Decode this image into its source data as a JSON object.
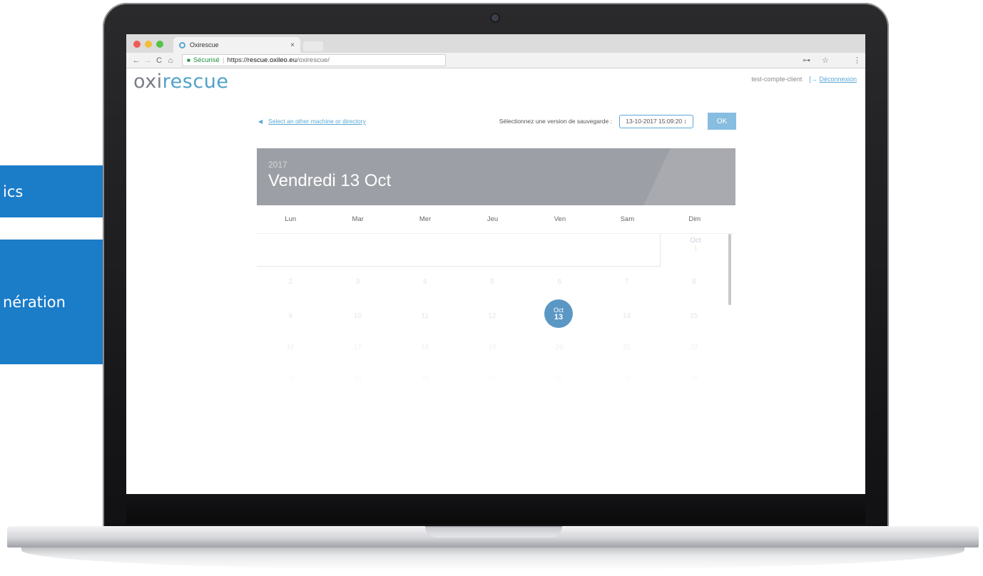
{
  "side_boxes": {
    "box1_text": "ics",
    "box2_text": "nération"
  },
  "browser": {
    "tab_title": "Oxirescue",
    "tab_close": "×",
    "nav": {
      "back": "←",
      "forward": "→",
      "reload": "C",
      "home": "⌂"
    },
    "address": {
      "secure_label": "Sécurisé",
      "separator": "|",
      "url_proto": "https://",
      "url_host": "rescue.oxileo.eu",
      "url_path": "/oxirescue/"
    },
    "toolbar_right": {
      "key": "⊶",
      "star": "☆",
      "menu": "⋮"
    }
  },
  "page": {
    "logo": {
      "part1": "oxi",
      "part2": "rescue"
    },
    "account": {
      "user": "test-compte-client",
      "logout_icon": "[→",
      "logout": "Déconnexion"
    },
    "selector": {
      "back_link": "Select an other machine or directory",
      "label": "Sélectionnez une version de sauvegarde :",
      "selected": "13-10-2017 15:09:20 ↕",
      "ok": "OK"
    },
    "calendar": {
      "year": "2017",
      "date": "Vendredi 13 Oct",
      "weekdays": [
        "Lun",
        "Mar",
        "Mer",
        "Jeu",
        "Ven",
        "Sam",
        "Dim"
      ],
      "first_month": "Oct",
      "first_day": "1",
      "weeks": [
        [
          "2",
          "3",
          "4",
          "5",
          "6",
          "7",
          "8"
        ],
        [
          "9",
          "10",
          "11",
          "12",
          "",
          "14",
          "15"
        ],
        [
          "16",
          "17",
          "18",
          "19",
          "20",
          "21",
          "22"
        ],
        [
          "23",
          "24",
          "25",
          "26",
          "27",
          "28",
          "29"
        ]
      ],
      "today": {
        "month": "Oct",
        "day": "13"
      }
    }
  },
  "colors": {
    "accent": "#5aa8d6",
    "header_bg": "#9c9fa5",
    "today_bg": "#5b97c4",
    "side_box": "#1b7cc8"
  }
}
